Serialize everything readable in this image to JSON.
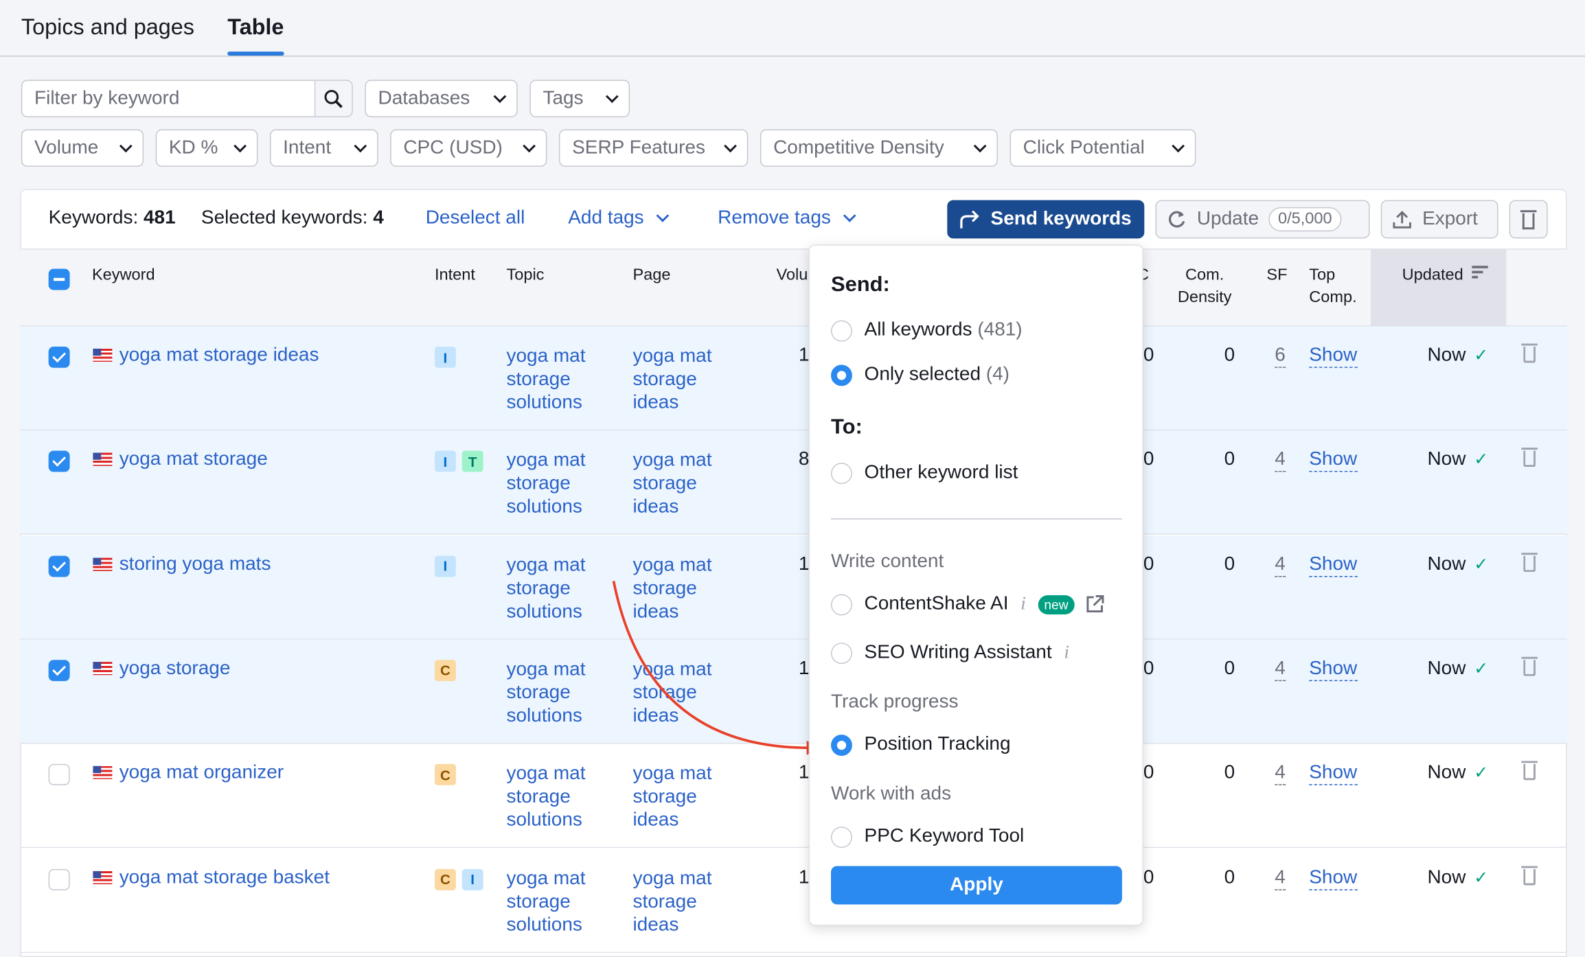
{
  "tabs": [
    {
      "label": "Topics and pages"
    },
    {
      "label": "Table",
      "active": true
    }
  ],
  "filters": {
    "keyword_placeholder": "Filter by keyword",
    "databases": "Databases",
    "tags": "Tags",
    "volume": "Volume",
    "kd": "KD %",
    "intent": "Intent",
    "cpc": "CPC (USD)",
    "serp": "SERP Features",
    "com_density": "Competitive Density",
    "click_potential": "Click Potential"
  },
  "toolbar": {
    "keywords_label": "Keywords:",
    "keywords_count": "481",
    "selected_label": "Selected keywords:",
    "selected_count": "4",
    "deselect_all": "Deselect all",
    "add_tags": "Add tags",
    "remove_tags": "Remove tags",
    "send_keywords": "Send keywords",
    "update": "Update",
    "update_quota": "0/5,000",
    "export": "Export"
  },
  "columns": {
    "keyword": "Keyword",
    "intent": "Intent",
    "topic": "Topic",
    "page": "Page",
    "volume": "Volu",
    "cpc": "C\n)",
    "com_density": "Com.\nDensity",
    "sf": "SF",
    "top_comp": "Top\nComp.",
    "updated": "Updated"
  },
  "rows": [
    {
      "selected": true,
      "keyword": "yoga mat storage ideas",
      "intents": [
        "I"
      ],
      "topic": "yoga mat\nstorage\nsolutions",
      "page": "yoga mat\nstorage\nideas",
      "volume": "1",
      "cpc": "0",
      "com_density": "0",
      "sf": "6",
      "top_comp": "Show",
      "updated": "Now"
    },
    {
      "selected": true,
      "keyword": "yoga mat storage",
      "intents": [
        "I",
        "T"
      ],
      "topic": "yoga mat\nstorage\nsolutions",
      "page": "yoga mat\nstorage\nideas",
      "volume": "8",
      "cpc": "0",
      "com_density": "0",
      "sf": "4",
      "top_comp": "Show",
      "updated": "Now"
    },
    {
      "selected": true,
      "keyword": "storing yoga mats",
      "intents": [
        "I"
      ],
      "topic": "yoga mat\nstorage\nsolutions",
      "page": "yoga mat\nstorage\nideas",
      "volume": "1",
      "cpc": "0",
      "com_density": "0",
      "sf": "4",
      "top_comp": "Show",
      "updated": "Now"
    },
    {
      "selected": true,
      "keyword": "yoga storage",
      "intents": [
        "C"
      ],
      "topic": "yoga mat\nstorage\nsolutions",
      "page": "yoga mat\nstorage\nideas",
      "volume": "1",
      "cpc": "0",
      "com_density": "0",
      "sf": "4",
      "top_comp": "Show",
      "updated": "Now"
    },
    {
      "selected": false,
      "keyword": "yoga mat organizer",
      "intents": [
        "C"
      ],
      "topic": "yoga mat\nstorage\nsolutions",
      "page": "yoga mat\nstorage\nideas",
      "volume": "1",
      "cpc": "0",
      "com_density": "0",
      "sf": "4",
      "top_comp": "Show",
      "updated": "Now"
    },
    {
      "selected": false,
      "keyword": "yoga mat storage basket",
      "intents": [
        "C",
        "I"
      ],
      "topic": "yoga mat\nstorage\nsolutions",
      "page": "yoga mat\nstorage\nideas",
      "volume": "1",
      "cpc": "0",
      "com_density": "0",
      "sf": "4",
      "top_comp": "Show",
      "updated": "Now"
    }
  ],
  "dropdown": {
    "send_title": "Send:",
    "all_keywords": "All keywords",
    "all_count": "(481)",
    "only_selected": "Only selected",
    "selected_count": "(4)",
    "to_title": "To:",
    "other_list": "Other keyword list",
    "write_content": "Write content",
    "contentshake": "ContentShake AI",
    "new_badge": "new",
    "seo_writing": "SEO Writing Assistant",
    "track_progress": "Track progress",
    "position_tracking": "Position Tracking",
    "work_with_ads": "Work with ads",
    "ppc_tool": "PPC Keyword Tool",
    "apply": "Apply",
    "selected_option": "Position Tracking"
  },
  "colors": {
    "accent": "#2b8af0",
    "send_button": "#1a4a8f",
    "link": "#2b62c8",
    "arrow": "#e8412b",
    "selected_row": "#edf6fe"
  }
}
